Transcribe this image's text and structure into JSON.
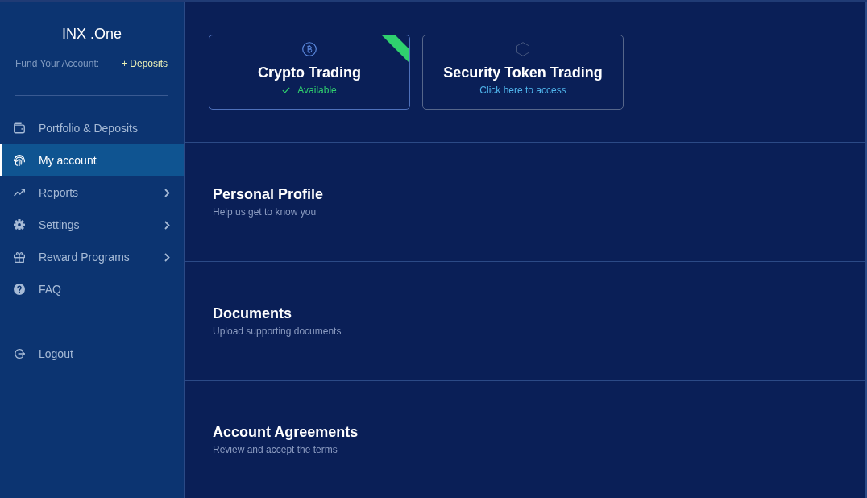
{
  "sidebar": {
    "brand": "INX .One",
    "fund_label": "Fund Your Account:",
    "deposits_link": "+ Deposits",
    "nav": [
      {
        "label": "Portfolio & Deposits",
        "selected": false,
        "expandable": false
      },
      {
        "label": "My account",
        "selected": true,
        "expandable": false
      },
      {
        "label": "Reports",
        "selected": false,
        "expandable": true
      },
      {
        "label": "Settings",
        "selected": false,
        "expandable": true
      },
      {
        "label": "Reward Programs",
        "selected": false,
        "expandable": true
      },
      {
        "label": "FAQ",
        "selected": false,
        "expandable": false
      }
    ],
    "logout": "Logout"
  },
  "trading_cards": [
    {
      "kind": "available",
      "title": "Crypto Trading",
      "subtitle": "Available"
    },
    {
      "kind": "link",
      "title": "Security Token Trading",
      "subtitle": "Click here to access"
    }
  ],
  "sections": [
    {
      "title": "Personal Profile",
      "subtitle": "Help us get to know you"
    },
    {
      "title": "Documents",
      "subtitle": "Upload supporting documents"
    },
    {
      "title": "Account Agreements",
      "subtitle": "Review and accept the terms"
    }
  ]
}
